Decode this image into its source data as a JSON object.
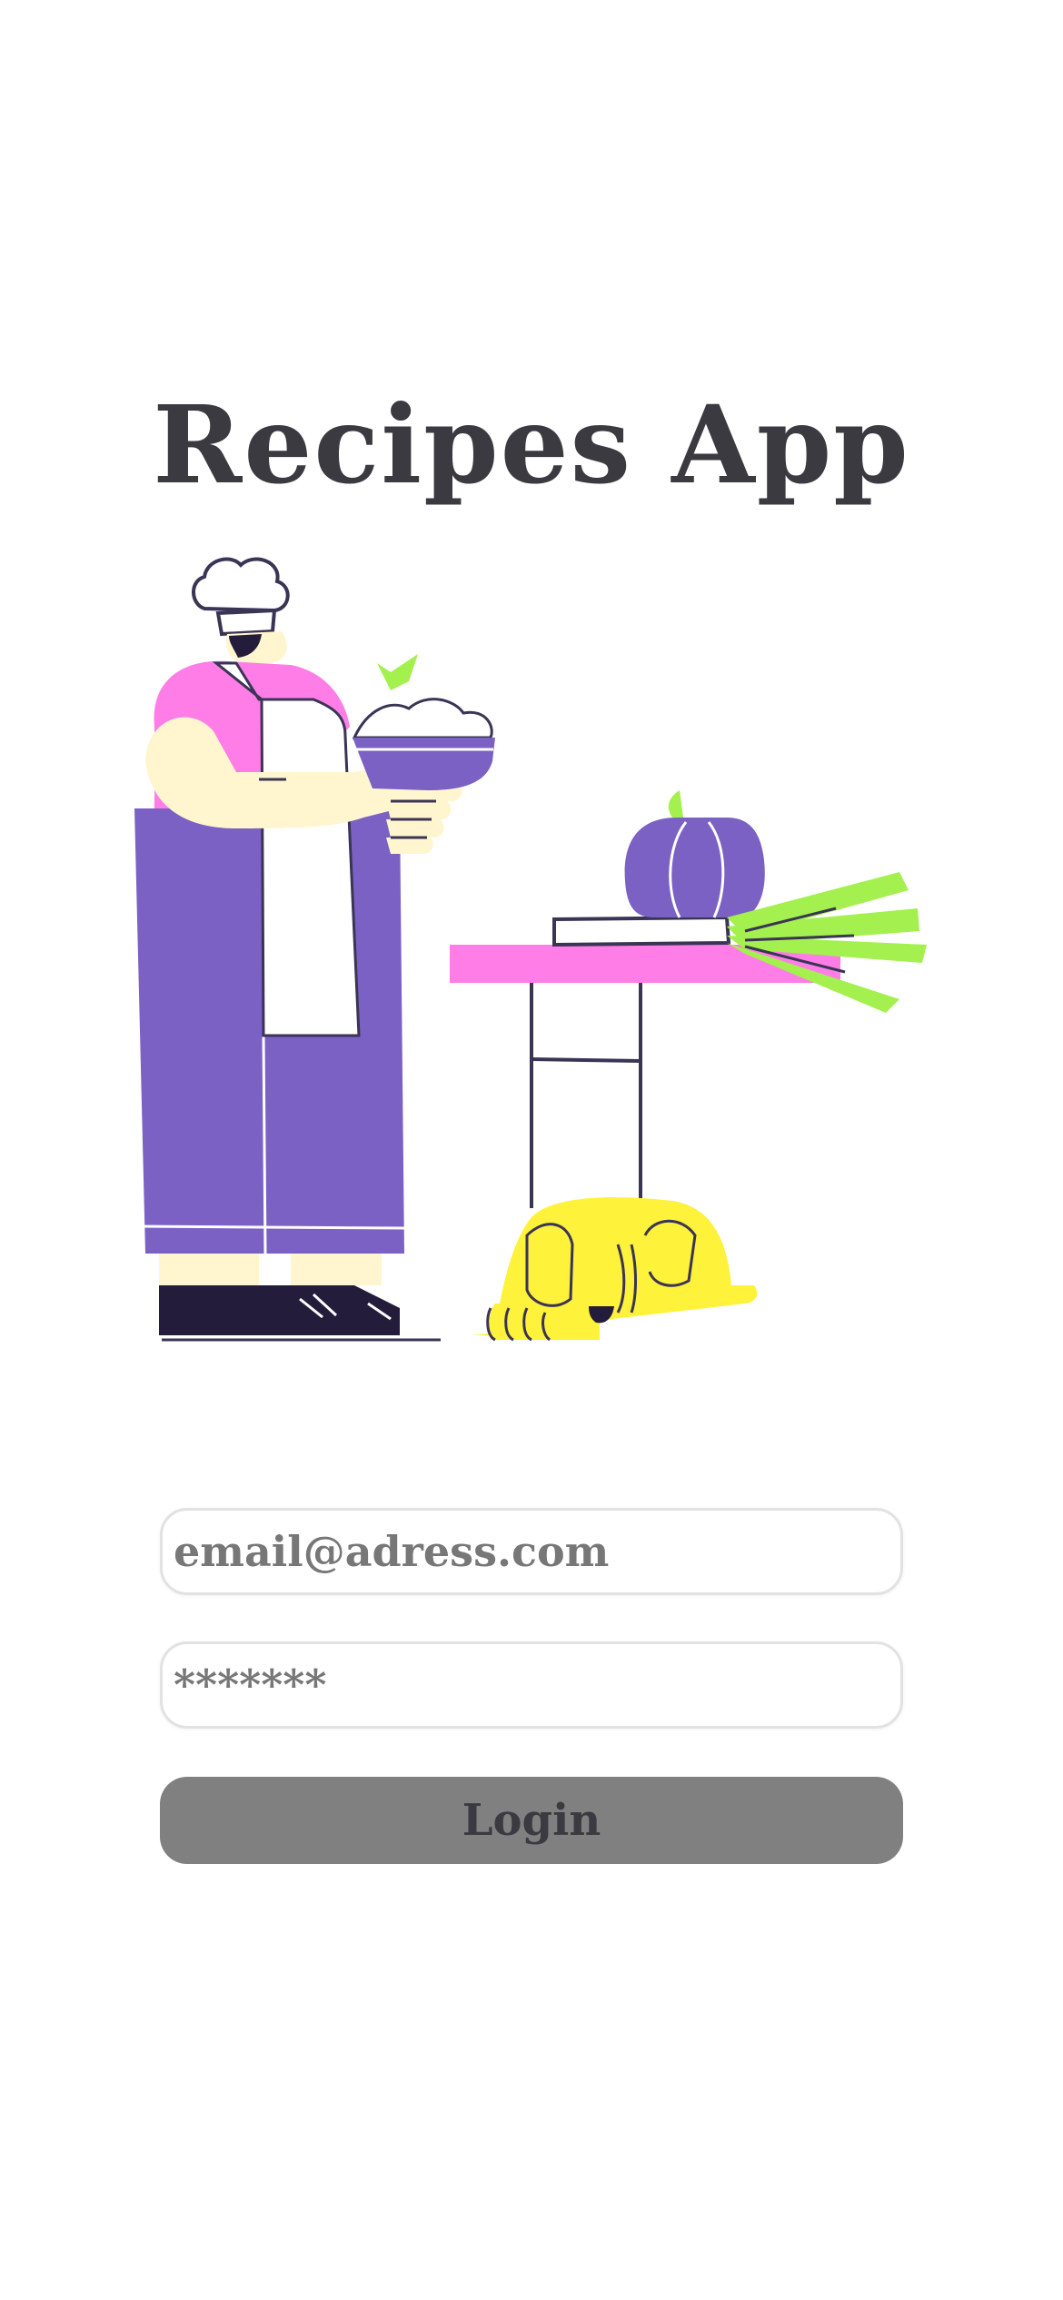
{
  "app": {
    "title": "Recipes App"
  },
  "illustration": {
    "description_name": "chef-with-dog-illustration",
    "colors": {
      "purple": "#7b61c4",
      "pink": "#ff7de6",
      "skin": "#fff6cf",
      "green": "#a3f04f",
      "yellow": "#fff23a",
      "outline": "#3a3455",
      "shoe": "#231d3b"
    }
  },
  "login_form": {
    "email_placeholder": "email@adress.com",
    "password_placeholder": "*******",
    "login_label": "Login"
  },
  "colors": {
    "title": "#3a3a40",
    "button_bg": "#808080",
    "field_border": "#e2e2e2",
    "placeholder": "#777777"
  }
}
